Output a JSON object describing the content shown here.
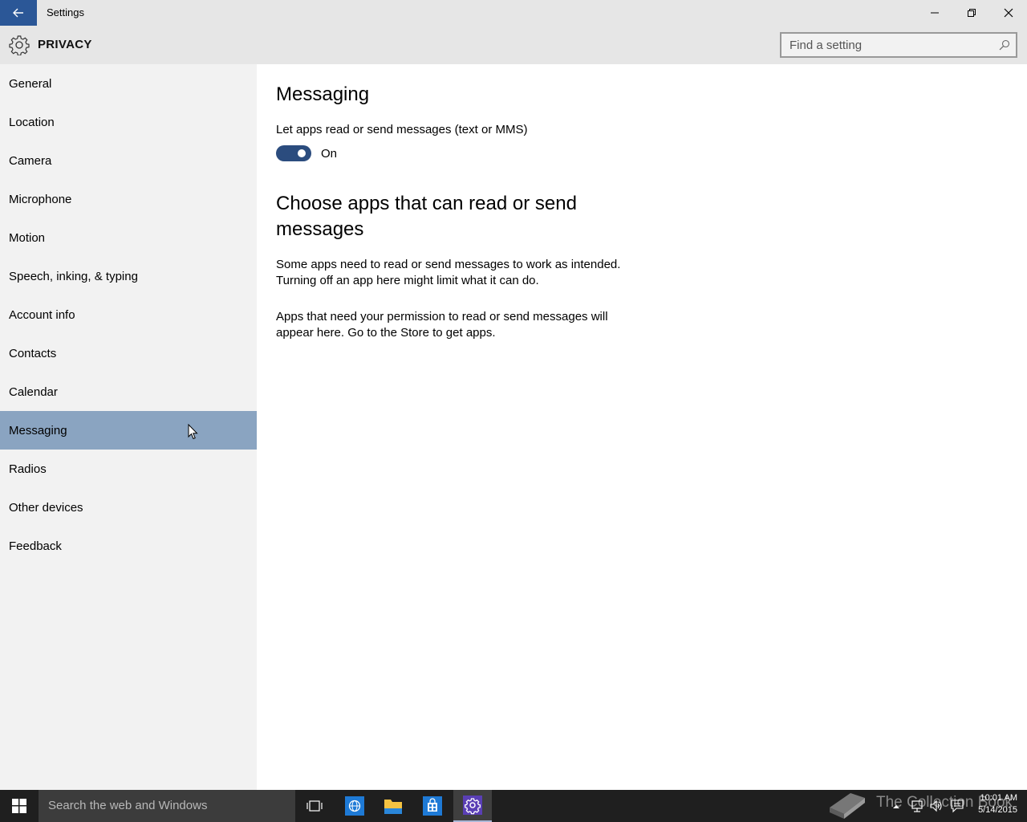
{
  "window": {
    "title": "Settings"
  },
  "header": {
    "title": "PRIVACY",
    "search_placeholder": "Find a setting"
  },
  "sidebar": {
    "items": [
      {
        "label": "General"
      },
      {
        "label": "Location"
      },
      {
        "label": "Camera"
      },
      {
        "label": "Microphone"
      },
      {
        "label": "Motion"
      },
      {
        "label": "Speech, inking, & typing"
      },
      {
        "label": "Account info"
      },
      {
        "label": "Contacts"
      },
      {
        "label": "Calendar"
      },
      {
        "label": "Messaging",
        "selected": true
      },
      {
        "label": "Radios"
      },
      {
        "label": "Other devices"
      },
      {
        "label": "Feedback"
      }
    ]
  },
  "main": {
    "title": "Messaging",
    "toggle_label": "Let apps read or send messages (text or MMS)",
    "toggle_state": "On",
    "toggle_on": true,
    "section_title": "Choose apps that can read or send messages",
    "paragraph1": "Some apps need to read or send messages to work as intended. Turning off an app here might limit what it can do.",
    "paragraph2": "Apps that need your permission to read or send messages will appear here. Go to the Store to get apps."
  },
  "taskbar": {
    "search_text": "Search the web and Windows",
    "watermark": "The Collection Book",
    "time": "10:01 AM",
    "date": "5/14/2015"
  },
  "colors": {
    "accent": "#2b5797",
    "selected_item": "#8aa4c1",
    "toggle_on": "#2b4c7e",
    "taskbar": "#1f1f1f",
    "chrome": "#e6e6e6",
    "sidebar": "#f2f2f2"
  },
  "icons": {
    "back": "arrow-left-icon",
    "header": "gear-icon",
    "search": "magnifier-icon",
    "start": "windows-logo-icon",
    "task_view": "task-view-icon",
    "browser": "browser-icon",
    "explorer": "folder-icon",
    "store": "store-icon",
    "settings": "gear-icon"
  }
}
